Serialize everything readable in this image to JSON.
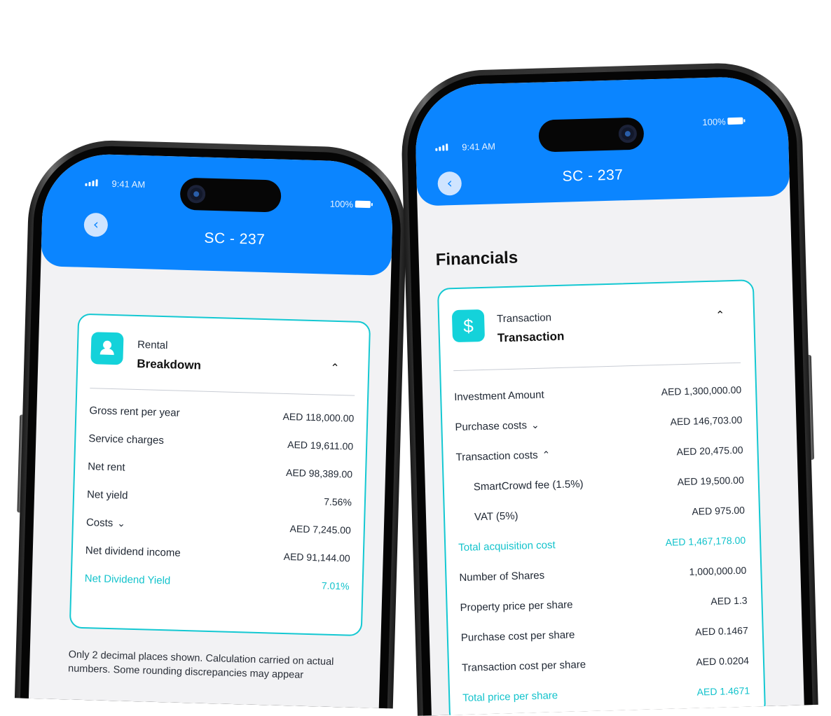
{
  "status_bar": {
    "time": "9:41 AM",
    "battery": "100%"
  },
  "left_phone": {
    "header": {
      "title": "SC - 237",
      "back_icon": "chevron-left-icon"
    },
    "card": {
      "icon": "user-icon",
      "subtitle": "Rental",
      "title": "Breakdown",
      "toggle_icon": "chevron-up-icon",
      "rows": [
        {
          "label": "Gross rent per year",
          "value": "AED 118,000.00"
        },
        {
          "label": "Service charges",
          "value": "AED 19,611.00"
        },
        {
          "label": "Net rent",
          "value": "AED 98,389.00"
        },
        {
          "label": "Net yield",
          "value": "7.56%"
        },
        {
          "label": "Costs",
          "value": "AED 7,245.00",
          "toggle": "chevron-down-icon"
        },
        {
          "label": "Net dividend income",
          "value": "AED 91,144.00"
        },
        {
          "label": "Net Dividend Yield",
          "value": "7.01%",
          "accent": true
        }
      ]
    },
    "note": "Only 2 decimal places shown. Calculation carried on actual numbers. Some rounding discrepancies may appear"
  },
  "right_phone": {
    "header": {
      "title": "SC - 237",
      "back_icon": "chevron-left-icon"
    },
    "section_title": "Financials",
    "card": {
      "icon": "dollar-icon",
      "subtitle": "Transaction",
      "title": "Transaction",
      "toggle_icon": "chevron-up-icon",
      "rows": [
        {
          "label": "Investment Amount",
          "value": "AED 1,300,000.00"
        },
        {
          "label": "Purchase costs",
          "value": "AED 146,703.00",
          "toggle": "chevron-down-icon"
        },
        {
          "label": "Transaction costs",
          "value": "AED 20,475.00",
          "toggle": "chevron-up-icon"
        },
        {
          "label": "SmartCrowd fee (1.5%)",
          "value": "AED 19,500.00",
          "indent": true
        },
        {
          "label": "VAT (5%)",
          "value": "AED 975.00",
          "indent": true
        },
        {
          "label": "Total acquisition cost",
          "value": "AED 1,467,178.00",
          "accent": true
        },
        {
          "label": "Number of Shares",
          "value": "1,000,000.00"
        },
        {
          "label": "Property price per share",
          "value": "AED 1.3"
        },
        {
          "label": "Purchase cost per share",
          "value": "AED 0.1467"
        },
        {
          "label": "Transaction cost per share",
          "value": "AED 0.0204"
        },
        {
          "label": "Total price per share",
          "value": "AED 1.4671",
          "accent": true
        }
      ]
    }
  },
  "colors": {
    "header_blue": "#0b85ff",
    "accent_teal": "#14c8d2",
    "screen_bg": "#f2f2f4"
  }
}
